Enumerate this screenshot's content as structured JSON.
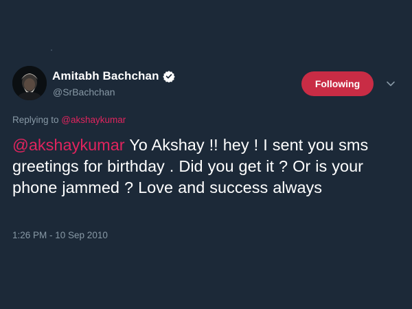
{
  "colors": {
    "background": "#1c2938",
    "accent": "#e0245e",
    "follow_button": "#c92c45",
    "secondary_text": "#8899a6"
  },
  "author": {
    "display_name": "Amitabh Bachchan",
    "handle": "@SrBachchan",
    "verified_icon": "verified-badge-icon",
    "avatar_icon": "profile-avatar"
  },
  "actions": {
    "follow_label": "Following",
    "more_icon": "chevron-down-icon"
  },
  "reply_context": {
    "prefix": "Replying to ",
    "mention": "@akshaykumar"
  },
  "tweet": {
    "mention": "@akshaykumar",
    "body": " Yo Akshay !! hey ! I sent you sms greetings for birthday . Did you get it ? Or is your phone jammed ? Love and success always",
    "timestamp": "1:26 PM - 10 Sep 2010"
  }
}
